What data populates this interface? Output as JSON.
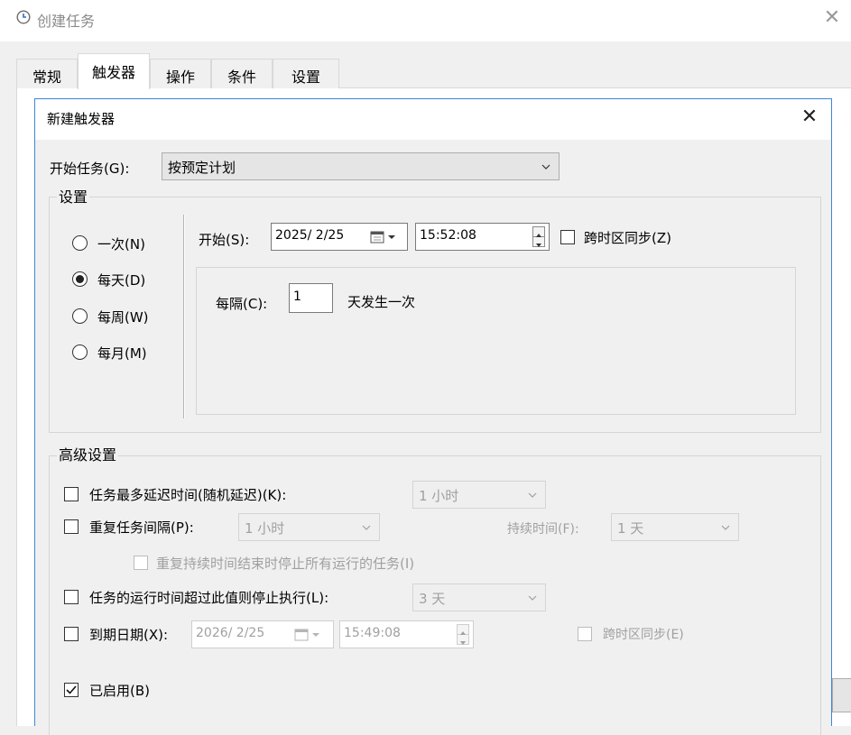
{
  "window": {
    "title": "创建任务",
    "close_glyph": "✕"
  },
  "tabs": [
    {
      "label": "常规",
      "active": false
    },
    {
      "label": "触发器",
      "active": true
    },
    {
      "label": "操作",
      "active": false
    },
    {
      "label": "条件",
      "active": false
    },
    {
      "label": "设置",
      "active": false
    }
  ],
  "dialog": {
    "title": "新建触发器",
    "close_glyph": "✕",
    "begin_task": {
      "label": "开始任务(G):",
      "value": "按预定计划"
    },
    "settings_group": {
      "title": "设置",
      "radios": [
        {
          "label": "一次(N)",
          "selected": false
        },
        {
          "label": "每天(D)",
          "selected": true
        },
        {
          "label": "每周(W)",
          "selected": false
        },
        {
          "label": "每月(M)",
          "selected": false
        }
      ],
      "start_label": "开始(S):",
      "start_date": "2025/ 2/25",
      "start_time": "15:52:08",
      "sync_timezone": {
        "label": "跨时区同步(Z)",
        "checked": false
      },
      "recur_label": "每隔(C):",
      "recur_value": "1",
      "recur_suffix": "天发生一次"
    },
    "advanced": {
      "title": "高级设置",
      "delay": {
        "label": "任务最多延迟时间(随机延迟)(K):",
        "checked": false,
        "value": "1 小时"
      },
      "repeat": {
        "label": "重复任务间隔(P):",
        "checked": false,
        "value": "1 小时",
        "duration_label": "持续时间(F):",
        "duration_value": "1 天"
      },
      "stop_all": {
        "label": "重复持续时间结束时停止所有运行的任务(I)",
        "checked": false
      },
      "stop_if": {
        "label": "任务的运行时间超过此值则停止执行(L):",
        "checked": false,
        "value": "3 天"
      },
      "expire": {
        "label": "到期日期(X):",
        "checked": false,
        "date": "2026/ 2/25",
        "time": "15:49:08",
        "sync_label": "跨时区同步(E)",
        "sync_checked": false
      },
      "enabled": {
        "label": "已启用(B)",
        "checked": true
      }
    }
  },
  "colors": {
    "accent_border": "#3f86d6",
    "dialog_bg": "#f0f0f0",
    "disabled_text": "#a0a0a0"
  }
}
